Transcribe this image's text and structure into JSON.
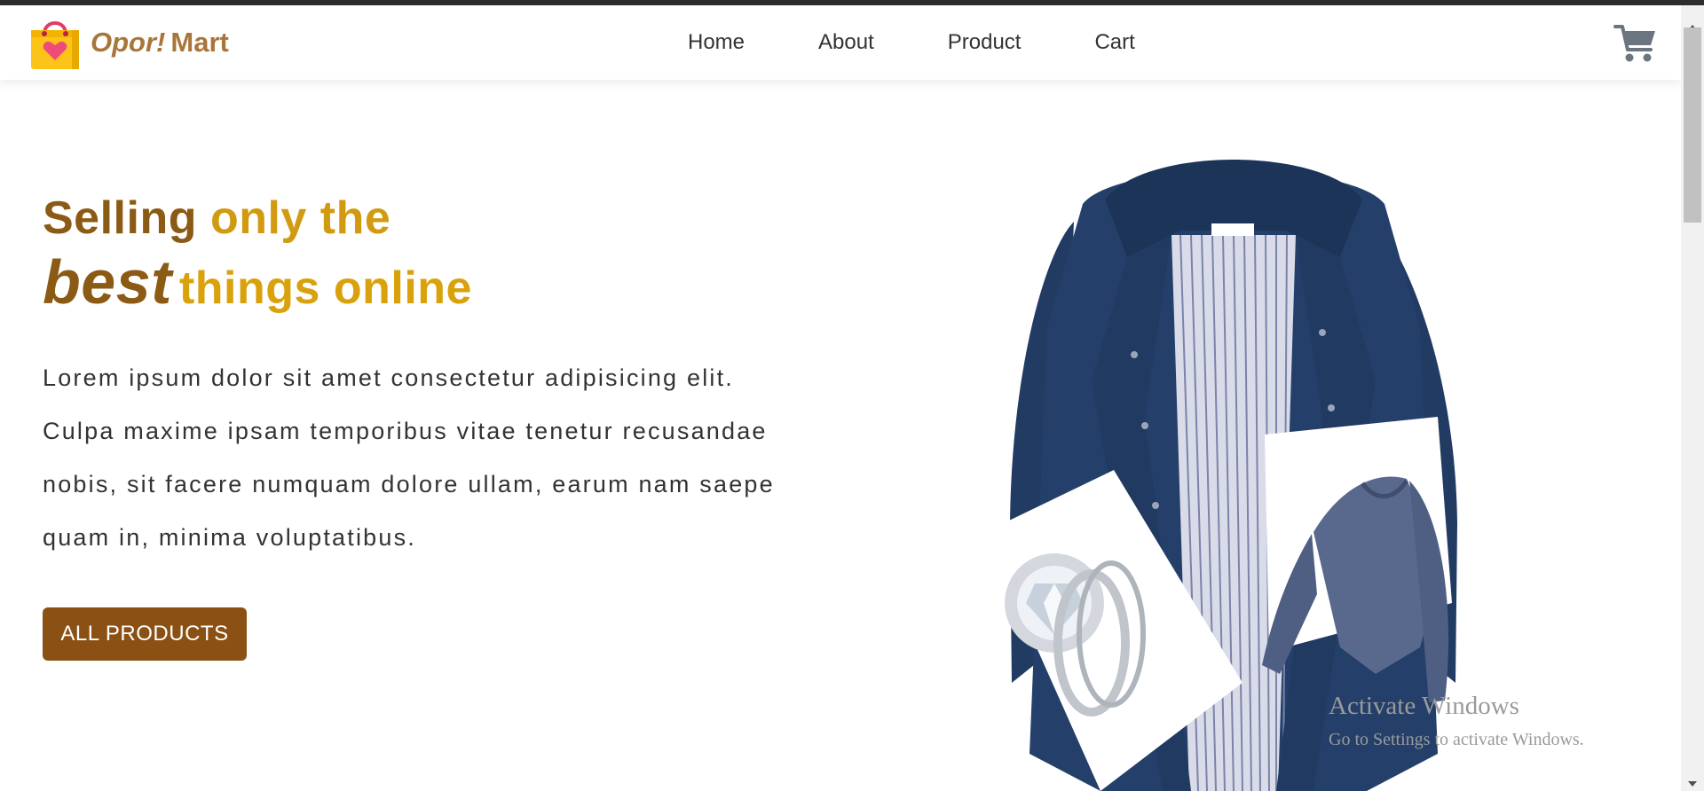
{
  "brand": {
    "italic_part": "Opor!",
    "plain_part": "Mart",
    "logo_icon": "shopping-bag-heart-icon"
  },
  "nav": {
    "items": [
      {
        "label": "Home"
      },
      {
        "label": "About"
      },
      {
        "label": "Product"
      },
      {
        "label": "Cart"
      }
    ]
  },
  "header": {
    "cart_icon": "shopping-cart-icon"
  },
  "hero": {
    "title_line1_dark": "Selling",
    "title_line1_gold": "only the",
    "title_line2_best": "best",
    "title_line2_gold": "things online",
    "description_lines": [
      "Lorem ipsum dolor sit amet consectetur adipisicing elit.",
      "Culpa maxime ipsam temporibus vitae tenetur recusandae",
      "nobis, sit facere numquam dolore ullam, earum nam saepe",
      "quam in, minima voluptatibus."
    ],
    "cta_label": "ALL PRODUCTS"
  },
  "images": [
    {
      "name": "navy jacket"
    },
    {
      "name": "diamond ring"
    },
    {
      "name": "long sleeve shirt"
    }
  ],
  "watermark": {
    "title": "Activate Windows",
    "subtitle": "Go to Settings to activate Windows."
  },
  "colors": {
    "brand": "#a9763a",
    "title_dark": "#8b5a14",
    "title_gold": "#d19a10",
    "button": "#8b5013"
  }
}
